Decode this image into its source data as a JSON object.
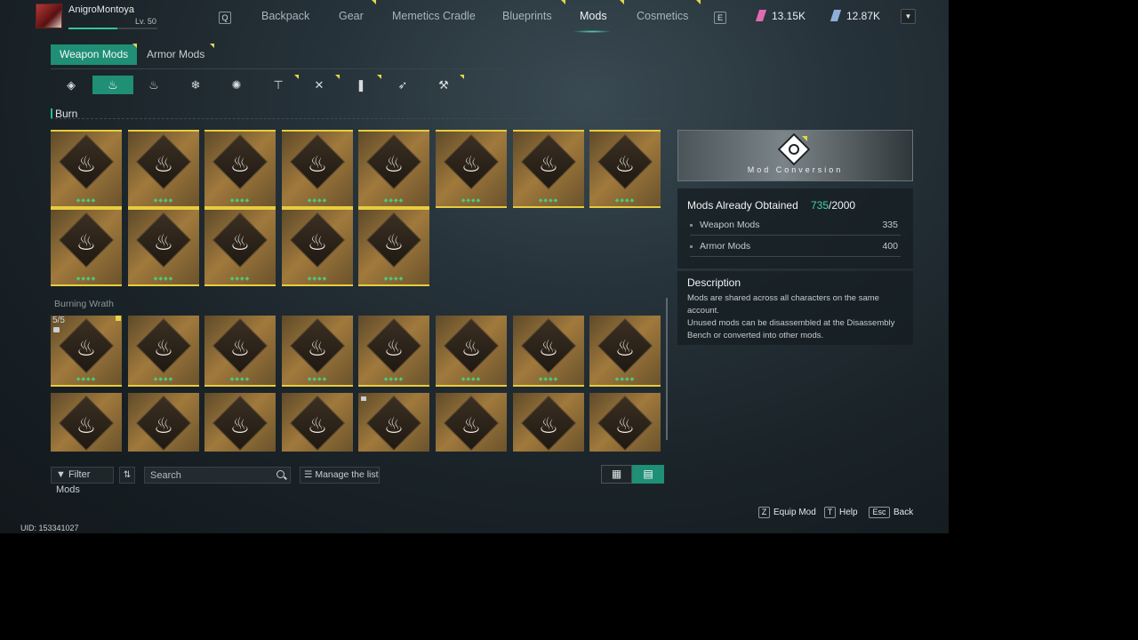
{
  "player": {
    "name": "AnigroMontoya",
    "level": "Lv. 50"
  },
  "nav": {
    "left_key": "Q",
    "right_key": "E",
    "tabs": [
      {
        "label": "Backpack"
      },
      {
        "label": "Gear"
      },
      {
        "label": "Memetics Cradle"
      },
      {
        "label": "Blueprints"
      },
      {
        "label": "Mods"
      },
      {
        "label": "Cosmetics"
      }
    ],
    "active_tab": "Mods"
  },
  "currencies": [
    {
      "value": "13.15K",
      "color": "#e26bb0"
    },
    {
      "value": "12.87K",
      "color": "#8fb0d6"
    }
  ],
  "sub_tabs": [
    "Weapon Mods",
    "Armor Mods"
  ],
  "category_icons": [
    {
      "icon": "all-diamond-icon",
      "glyph": "◈"
    },
    {
      "icon": "burn-icon",
      "glyph": "♨"
    },
    {
      "icon": "flame-icon",
      "glyph": "♨"
    },
    {
      "icon": "frost-icon",
      "glyph": "❄"
    },
    {
      "icon": "power-surge-icon",
      "glyph": "✺"
    },
    {
      "icon": "anvil-icon",
      "glyph": "⊤"
    },
    {
      "icon": "crossed-blades-icon",
      "glyph": "✕"
    },
    {
      "icon": "bullet-icon",
      "glyph": "❚"
    },
    {
      "icon": "arrow-icon",
      "glyph": "➶"
    },
    {
      "icon": "hammer-icon",
      "glyph": "⚒"
    }
  ],
  "sections": {
    "burn": "Burn",
    "burning_wrath": "Burning Wrath",
    "wrath_count": "5/5"
  },
  "search": {
    "placeholder": "Search"
  },
  "toolbar": {
    "filter": "Filter Mods",
    "manage": "Manage the list"
  },
  "conversion": {
    "label": "Mod Conversion"
  },
  "obtained": {
    "title": "Mods Already Obtained",
    "current": "735",
    "total": "/2000",
    "rows": [
      {
        "label": "Weapon Mods",
        "value": "335"
      },
      {
        "label": "Armor Mods",
        "value": "400"
      }
    ]
  },
  "description": {
    "title": "Description",
    "lines": [
      "Mods are shared across all characters on the same",
      "account.",
      "Unused mods can be disassembled at the Disassembly",
      "Bench or converted into other mods."
    ]
  },
  "hints": [
    {
      "key": "Z",
      "label": "Equip Mod"
    },
    {
      "key": "T",
      "label": "Help"
    },
    {
      "key": "Esc",
      "label": "Back"
    }
  ],
  "uid": "UID: 153341027",
  "colors": {
    "accent": "#1f8f75",
    "gold": "#e7cc3f",
    "highlight": "#3ed3ad"
  }
}
